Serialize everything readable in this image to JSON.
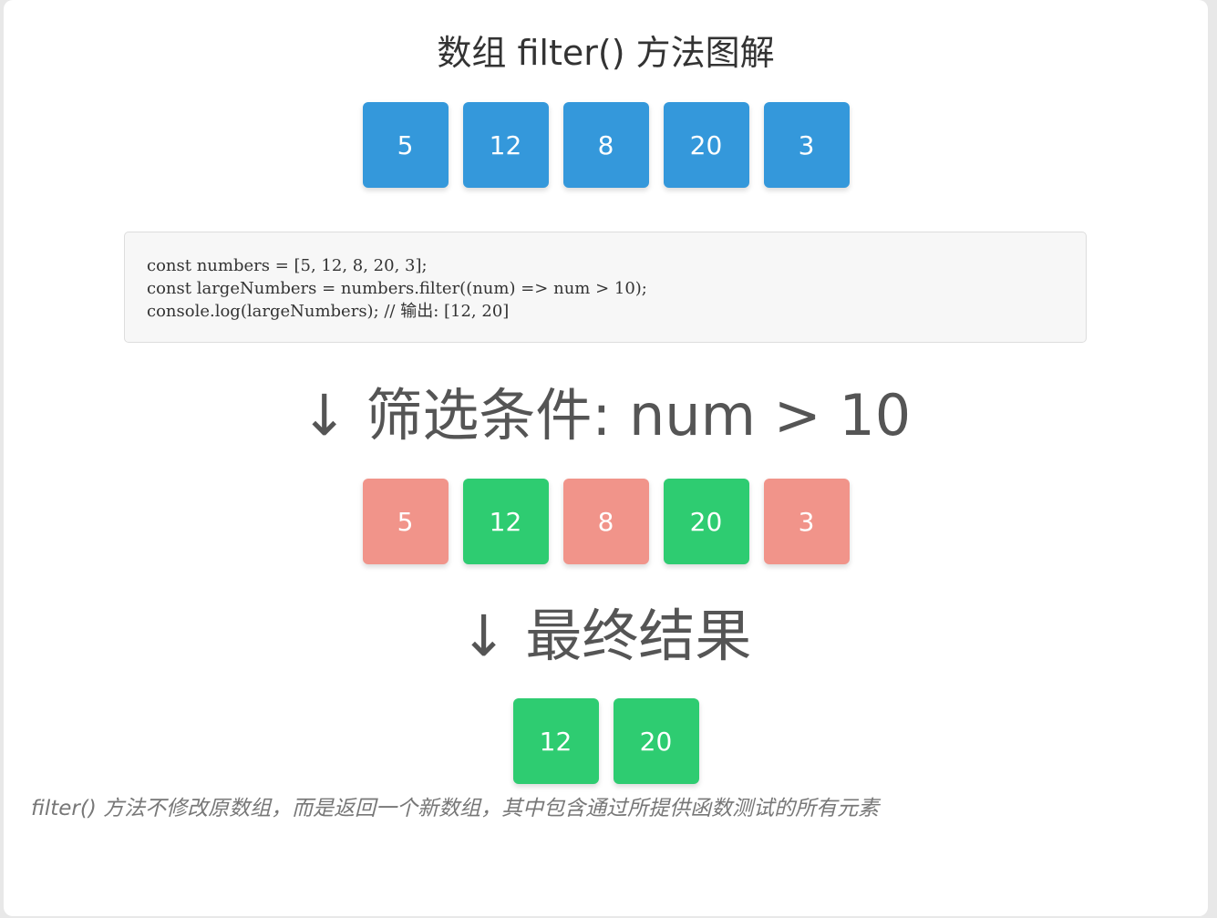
{
  "title": "数组 filter() 方法图解",
  "original_array": [
    {
      "value": "5",
      "color": "blue"
    },
    {
      "value": "12",
      "color": "blue"
    },
    {
      "value": "8",
      "color": "blue"
    },
    {
      "value": "20",
      "color": "blue"
    },
    {
      "value": "3",
      "color": "blue"
    }
  ],
  "code": {
    "lines": [
      "const numbers = [5, 12, 8, 20, 3];",
      "const largeNumbers = numbers.filter((num) => num > 10);",
      "console.log(largeNumbers); // 输出: [12, 20]"
    ]
  },
  "filter_step": {
    "label": "↓ 筛选条件: num > 10"
  },
  "filtered_array": [
    {
      "value": "5",
      "color": "red",
      "passes": false
    },
    {
      "value": "12",
      "color": "green",
      "passes": true
    },
    {
      "value": "8",
      "color": "red",
      "passes": false
    },
    {
      "value": "20",
      "color": "green",
      "passes": true
    },
    {
      "value": "3",
      "color": "red",
      "passes": false
    }
  ],
  "result_step": {
    "label": "↓ 最终结果"
  },
  "result_array": [
    {
      "value": "12",
      "color": "green"
    },
    {
      "value": "20",
      "color": "green"
    }
  ],
  "note": "filter() 方法不修改原数组，而是返回一个新数组，其中包含通过所提供函数测试的所有元素",
  "colors": {
    "blue": "#3498db",
    "green": "#2ecc71",
    "red": "#f1948a"
  }
}
